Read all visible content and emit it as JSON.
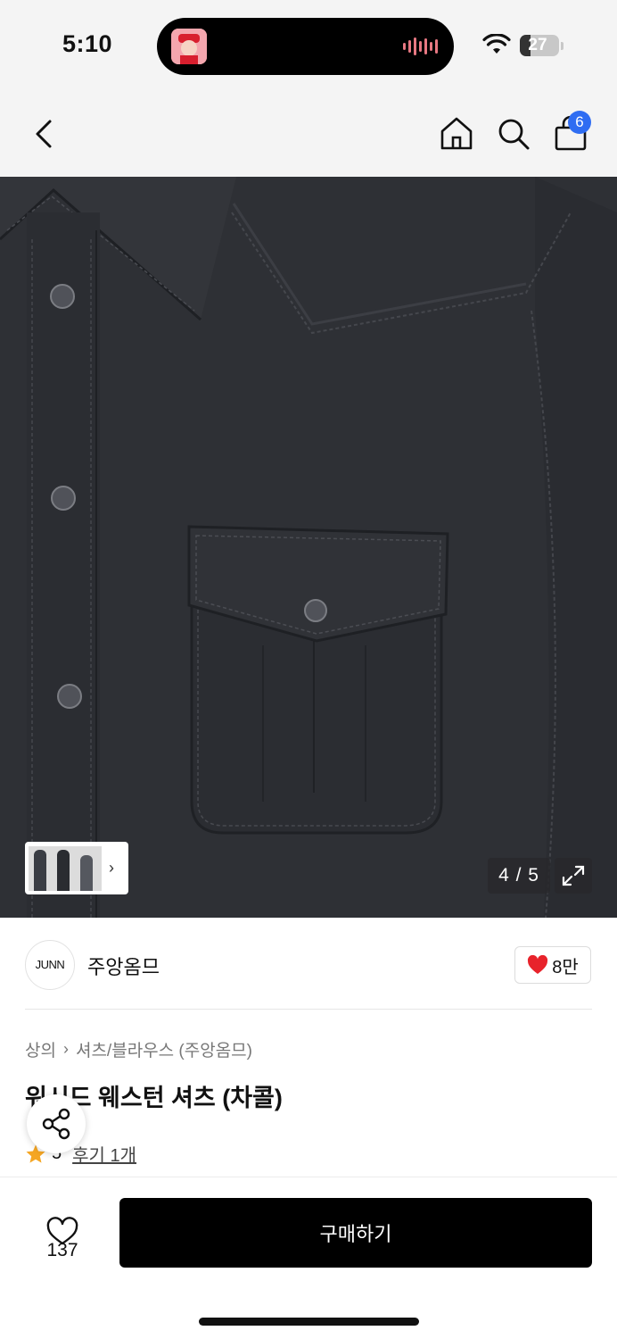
{
  "status_bar": {
    "time": "5:10",
    "battery": "27"
  },
  "nav": {
    "cart_count": "6"
  },
  "gallery": {
    "counter": "4 / 5"
  },
  "brand": {
    "logo_text": "JUNN",
    "name": "주앙옴므",
    "like_count": "8만"
  },
  "product": {
    "breadcrumb": [
      "상의",
      "셔츠/블라우스 (주앙옴므)"
    ],
    "title": "워시드 웨스턴 셔츠 (차콜)",
    "rating": "5",
    "review_label": "후기 1개"
  },
  "bottom_bar": {
    "wish_count": "137",
    "buy_label": "구매하기"
  },
  "colors": {
    "accent_blue": "#2f6df2",
    "heart_red": "#e8232b",
    "star": "#f5a623",
    "shirt": "#2c2e33"
  }
}
